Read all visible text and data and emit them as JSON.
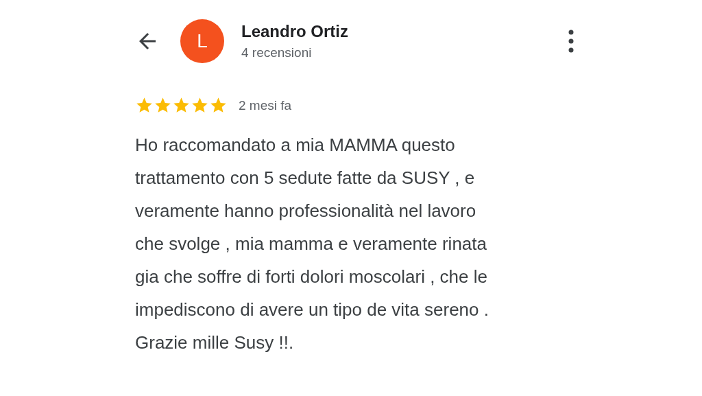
{
  "header": {
    "avatar_letter": "L",
    "name": "Leandro Ortiz",
    "subtitle": "4 recensioni"
  },
  "review": {
    "stars": 5,
    "date": "2 mesi fa",
    "text": "Ho raccomandato a mia MAMMA questo\ntrattamento con 5 sedute fatte da SUSY , e\nveramente hanno professionalità nel lavoro\nche svolge , mia mamma e veramente rinata\ngia che soffre di forti dolori moscolari , che le\nimpediscono di avere un tipo de vita sereno .\nGrazie mille Susy !!."
  }
}
